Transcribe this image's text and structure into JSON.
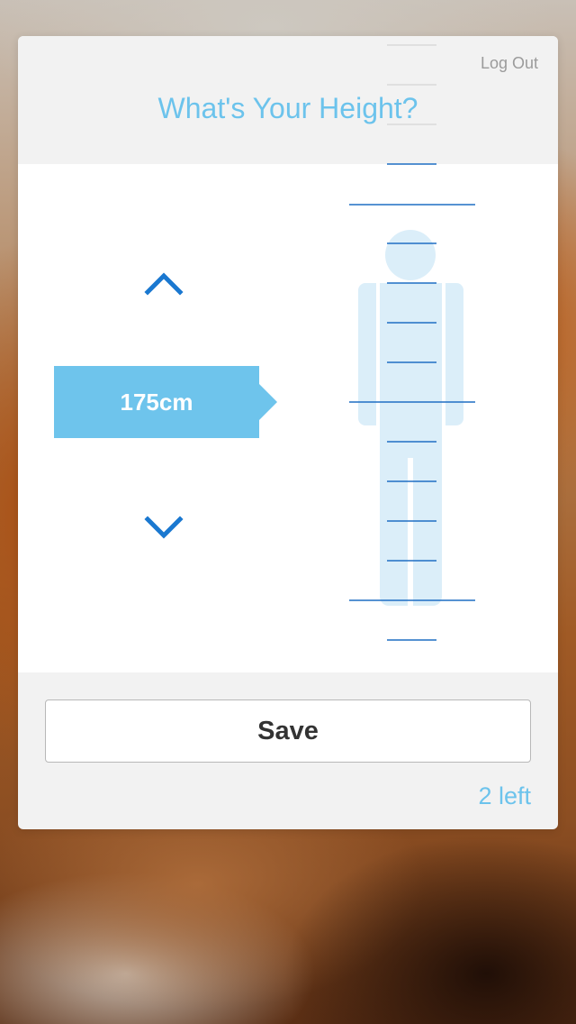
{
  "header": {
    "logout_label": "Log Out",
    "title": "What's Your Height?"
  },
  "height_picker": {
    "value": "175cm",
    "increase_icon": "chevron-up-icon",
    "decrease_icon": "chevron-down-icon",
    "figure_icon": "person-silhouette-icon"
  },
  "footer": {
    "save_label": "Save",
    "remaining": "2 left"
  },
  "colors": {
    "accent": "#6cc3ec",
    "badge": "#6ec4ec",
    "arrow": "#1a78d0",
    "ruler_line": "#1f6fc4",
    "figure": "#dbeef9"
  }
}
